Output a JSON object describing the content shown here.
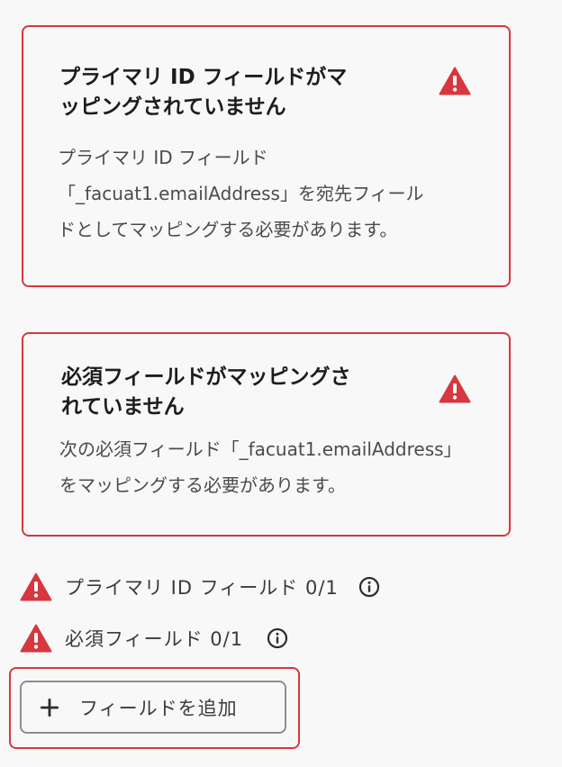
{
  "colors": {
    "alert_red": "#d7373f",
    "background": "#f8f8f8",
    "button_border": "#8e8e8e"
  },
  "cards": [
    {
      "title_lines": [
        "プライマリ ID フィールドがマ",
        "ッピングされていません"
      ],
      "body_lines": [
        "プライマリ ID フィールド",
        "「_facuat1.emailAddress」を宛先フィール",
        "ドとしてマッピングする必要があります。"
      ],
      "icon": "alert-triangle-icon"
    },
    {
      "title_lines": [
        "必須フィールドがマッピングさ",
        "れていません"
      ],
      "body_lines": [
        "次の必須フィールド「_facuat1.emailAddress」",
        "をマッピングする必要があります。"
      ],
      "icon": "alert-triangle-icon"
    }
  ],
  "status": [
    {
      "label": "プライマリ ID フィールド 0/1",
      "icon": "alert-triangle-icon",
      "info_icon": "info-icon"
    },
    {
      "label": "必須フィールド 0/1",
      "icon": "alert-triangle-icon",
      "info_icon": "info-icon"
    }
  ],
  "add_field_button": {
    "label": "フィールドを追加",
    "icon": "plus-icon"
  }
}
